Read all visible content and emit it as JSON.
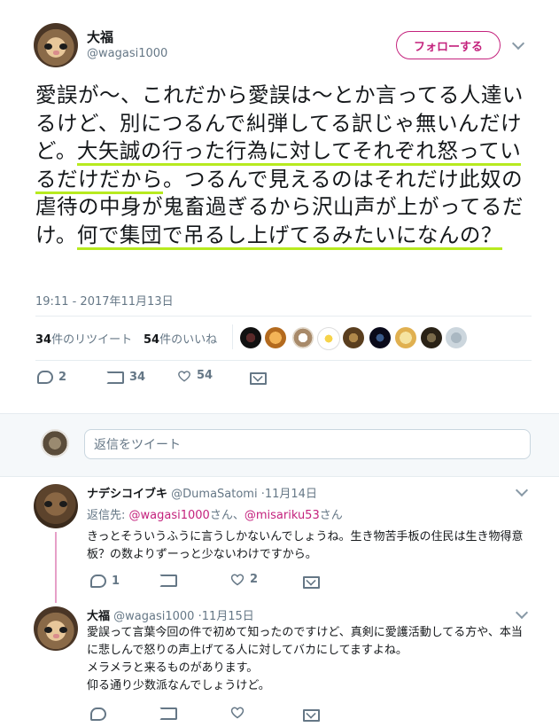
{
  "tweet": {
    "display_name": "大福",
    "handle": "@wagasi1000",
    "follow_label": "フォローする",
    "text": {
      "p1": "愛誤が〜、これだから愛誤は〜とか言ってる人達いるけど、別につるんで糾弾してる訳じゃ無いんだけど。",
      "hl1": "大矢誠の行った行為に対してそれぞれ怒っているだけだから",
      "p2": "。つるんで見えるのはそれだけ此奴の虐待の中身が鬼畜過ぎるから沢山声が上がってるだけ。",
      "hl2": "何で集団で吊るし上げてるみたいになんの？"
    },
    "timestamp": "19:11 - 2017年11月13日",
    "stats": {
      "retweets_num": "34",
      "retweets_label": "件のリツイート",
      "likes_num": "54",
      "likes_label": "件のいいね"
    },
    "actions": {
      "reply": "2",
      "retweet": "34",
      "like": "54"
    }
  },
  "reply_box": {
    "placeholder": "返信をツイート"
  },
  "replies": [
    {
      "display_name": "ナデシコイブキ",
      "handle": "@DumaSatomi",
      "date": "·11月14日",
      "reply_to_prefix": "返信先:",
      "reply_to_1": "@wagasi1000",
      "reply_to_mid": "さん、",
      "reply_to_2": "@misariku53",
      "reply_to_suffix": "さん",
      "text": "きっとそういうふうに言うしかないんでしょうね。生き物苦手板の住民は生き物得意板？の数よりずーっと少ないわけですから。",
      "reply_count": "1",
      "like_count": "2"
    },
    {
      "display_name": "大福",
      "handle": "@wagasi1000",
      "date": "·11月15日",
      "text": "愛誤って言葉今回の件で初めて知ったのですけど、真剣に愛護活動してる方や、本当に悲しんで怒りの声上げてる人に対してバカにしてますよね。\nメラメラと来るものがあります。\n仰る通り少数派なんでしょうけど。"
    }
  ],
  "colors": {
    "accent": "#c4227d",
    "highlight": "#b7ea1f",
    "muted": "#657786"
  }
}
